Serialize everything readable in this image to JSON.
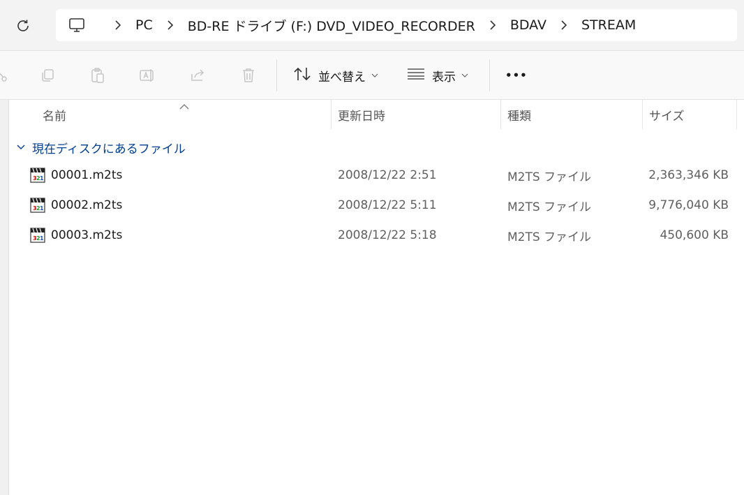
{
  "breadcrumb": {
    "items": [
      "PC",
      "BD-RE ドライブ (F:) DVD_VIDEO_RECORDER",
      "BDAV",
      "STREAM"
    ]
  },
  "toolbar": {
    "sort_label": "並べ替え",
    "view_label": "表示",
    "more_label": "•••"
  },
  "columns": {
    "name": "名前",
    "date": "更新日時",
    "type": "種類",
    "size": "サイズ"
  },
  "group": {
    "label": "現在ディスクにあるファイル"
  },
  "files": [
    {
      "name": "00001.m2ts",
      "date": "2008/12/22 2:51",
      "type": "M2TS ファイル",
      "size": "2,363,346 KB"
    },
    {
      "name": "00002.m2ts",
      "date": "2008/12/22 5:11",
      "type": "M2TS ファイル",
      "size": "9,776,040 KB"
    },
    {
      "name": "00003.m2ts",
      "date": "2008/12/22 5:18",
      "type": "M2TS ファイル",
      "size": "450,600 KB"
    }
  ],
  "icons": {
    "refresh": "refresh-icon",
    "pc": "computer-icon",
    "file": "media-file-icon"
  },
  "colors": {
    "group_text": "#003e92",
    "toolbar_bg": "#f9f9f9",
    "addressbar_bg": "#f3f3f3"
  }
}
